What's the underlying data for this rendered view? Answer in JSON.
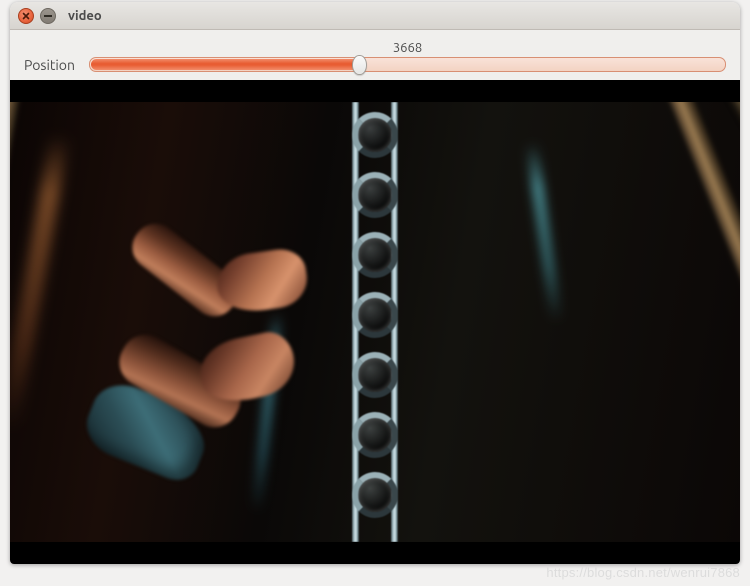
{
  "window": {
    "title": "video"
  },
  "controls": {
    "position_label": "Position",
    "position_value": "3668"
  },
  "watermark": {
    "text": "https://blog.csdn.net/wenrui7868"
  }
}
